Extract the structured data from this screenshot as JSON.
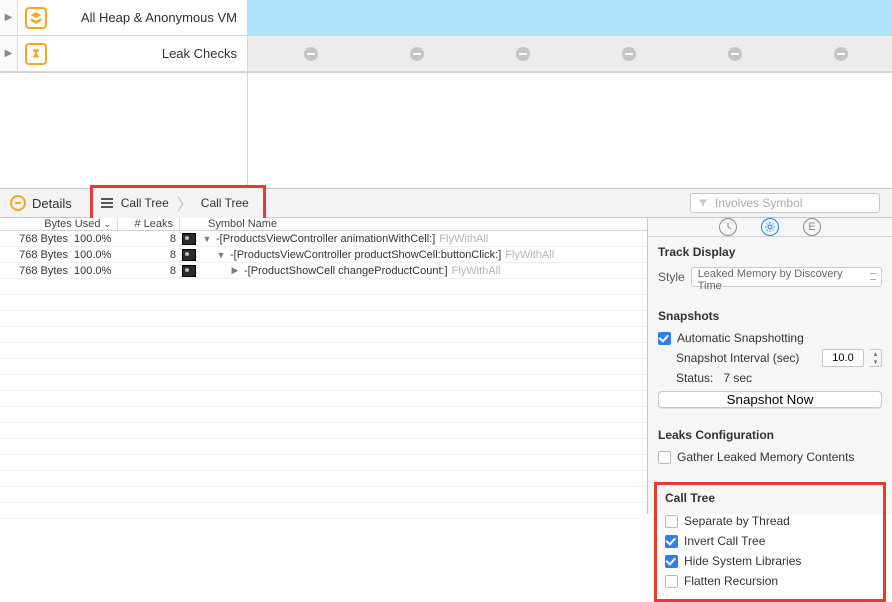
{
  "tracks": {
    "allocations": {
      "label": "All Heap & Anonymous VM"
    },
    "leaks": {
      "label": "Leak Checks",
      "marker_count": 6
    }
  },
  "toolbar": {
    "details_label": "Details",
    "breadcrumb": [
      "Call Tree",
      "Call Tree"
    ],
    "filter_placeholder": "Involves Symbol"
  },
  "columns": {
    "bytes": "Bytes Used",
    "leaks": "# Leaks",
    "symbol": "Symbol Name"
  },
  "rows": [
    {
      "bytes": "768 Bytes",
      "pct": "100.0%",
      "leaks": "8",
      "indent": 0,
      "arrow": "down",
      "symbol": "-[ProductsViewController animationWithCell:]",
      "lib": "FlyWithAll"
    },
    {
      "bytes": "768 Bytes",
      "pct": "100.0%",
      "leaks": "8",
      "indent": 1,
      "arrow": "down",
      "symbol": "-[ProductsViewController productShowCell:buttonClick:]",
      "lib": "FlyWithAll"
    },
    {
      "bytes": "768 Bytes",
      "pct": "100.0%",
      "leaks": "8",
      "indent": 2,
      "arrow": "right",
      "symbol": "-[ProductShowCell changeProductCount:]",
      "lib": "FlyWithAll"
    }
  ],
  "inspector": {
    "tabs": {
      "active_index": 1
    },
    "track_display": {
      "title": "Track Display",
      "style_label": "Style",
      "style_value": "Leaked Memory by Discovery Time"
    },
    "snapshots": {
      "title": "Snapshots",
      "auto_label": "Automatic Snapshotting",
      "auto_checked": true,
      "interval_label": "Snapshot Interval (sec)",
      "interval_value": "10.0",
      "status_label": "Status:",
      "status_value": "7 sec",
      "button_label": "Snapshot Now"
    },
    "leaks_config": {
      "title": "Leaks Configuration",
      "gather_label": "Gather Leaked Memory Contents",
      "gather_checked": false
    },
    "call_tree": {
      "title": "Call Tree",
      "options": [
        {
          "label": "Separate by Thread",
          "checked": false
        },
        {
          "label": "Invert Call Tree",
          "checked": true
        },
        {
          "label": "Hide System Libraries",
          "checked": true
        },
        {
          "label": "Flatten Recursion",
          "checked": false
        }
      ]
    }
  }
}
